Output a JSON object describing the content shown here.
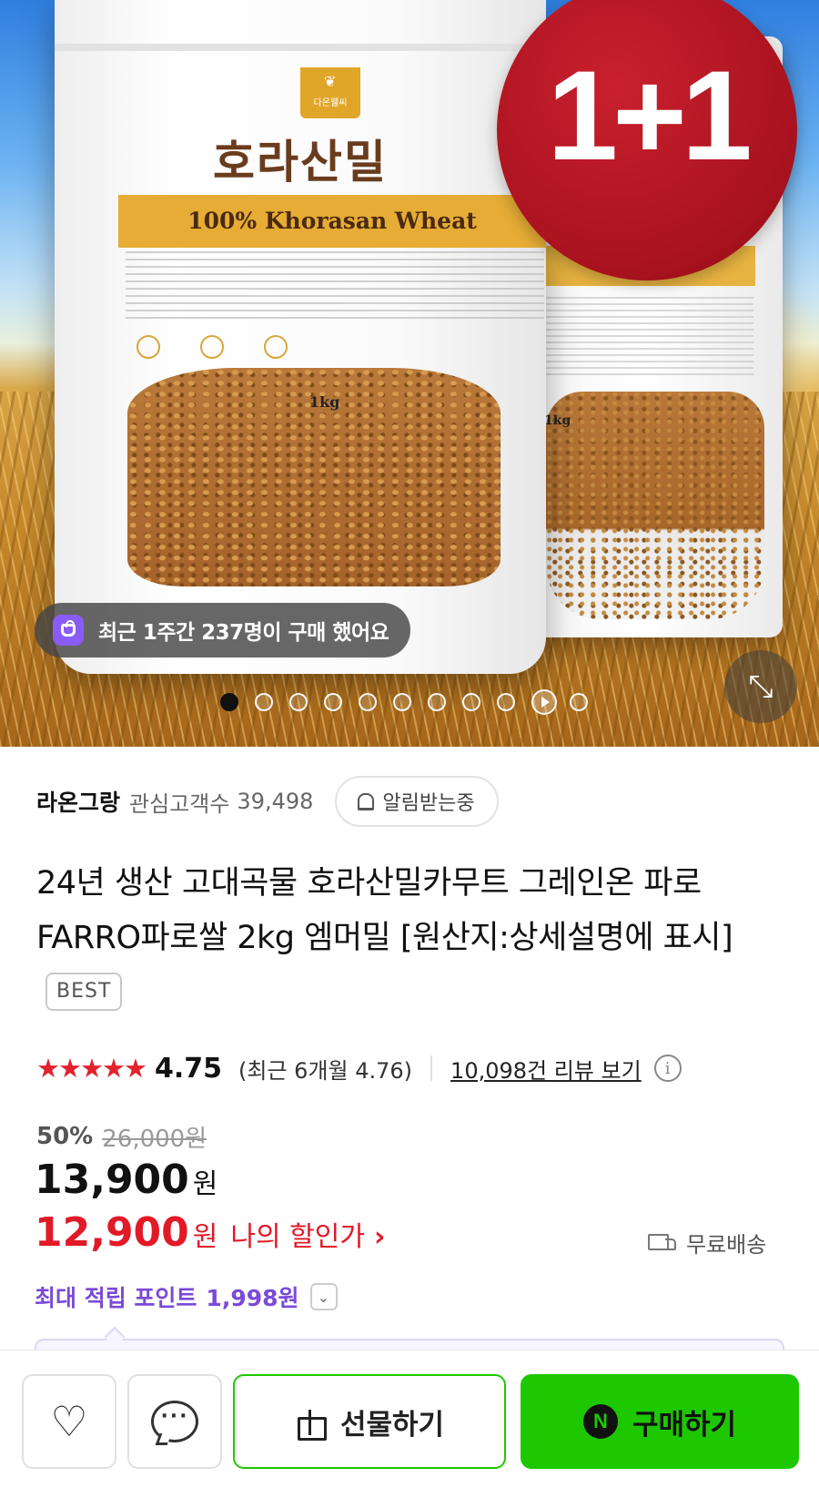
{
  "hero": {
    "bag_logo_text": "다온웰씨",
    "bag_title": "호라산밀",
    "bag_band_text": "100% Khorasan Wheat",
    "bag_weight": "1kg",
    "promo_badge": "1+1",
    "recent_purchase_text": "최근 1주간 237명이 구매 했어요",
    "carousel": {
      "total": 11,
      "active_index": 0,
      "video_index": 9
    }
  },
  "store": {
    "name": "라온그랑",
    "followers_label": "관심고객수",
    "followers_count": "39,498",
    "notify_label": "알림받는중"
  },
  "product": {
    "title": "24년 생산 고대곡물 호라산밀카무트 그레인온 파로 FARRO파로쌀 2kg 엠머밀 [원산지:상세설명에 표시]",
    "badge": "BEST"
  },
  "rating": {
    "stars": "★★★★★",
    "value": "4.75",
    "recent": "(최근 6개월 4.76)",
    "review_link": "10,098건 리뷰 보기"
  },
  "price": {
    "discount_rate": "50%",
    "original": "26,000원",
    "sale": "13,900",
    "sale_unit": "원",
    "my_price": "12,900",
    "my_price_unit": "원",
    "my_price_label": "나의 할인가",
    "shipping": "무료배송"
  },
  "points": {
    "label": "최대 적립 포인트",
    "value": "1,998원"
  },
  "bottom_bar": {
    "gift_label": "선물하기",
    "buy_label": "구매하기",
    "npay_glyph": "N"
  },
  "colors": {
    "accent_red": "#e21927",
    "naver_green": "#1ec800",
    "points_purple": "#7a4ad8",
    "promo_red": "#a8121e"
  }
}
